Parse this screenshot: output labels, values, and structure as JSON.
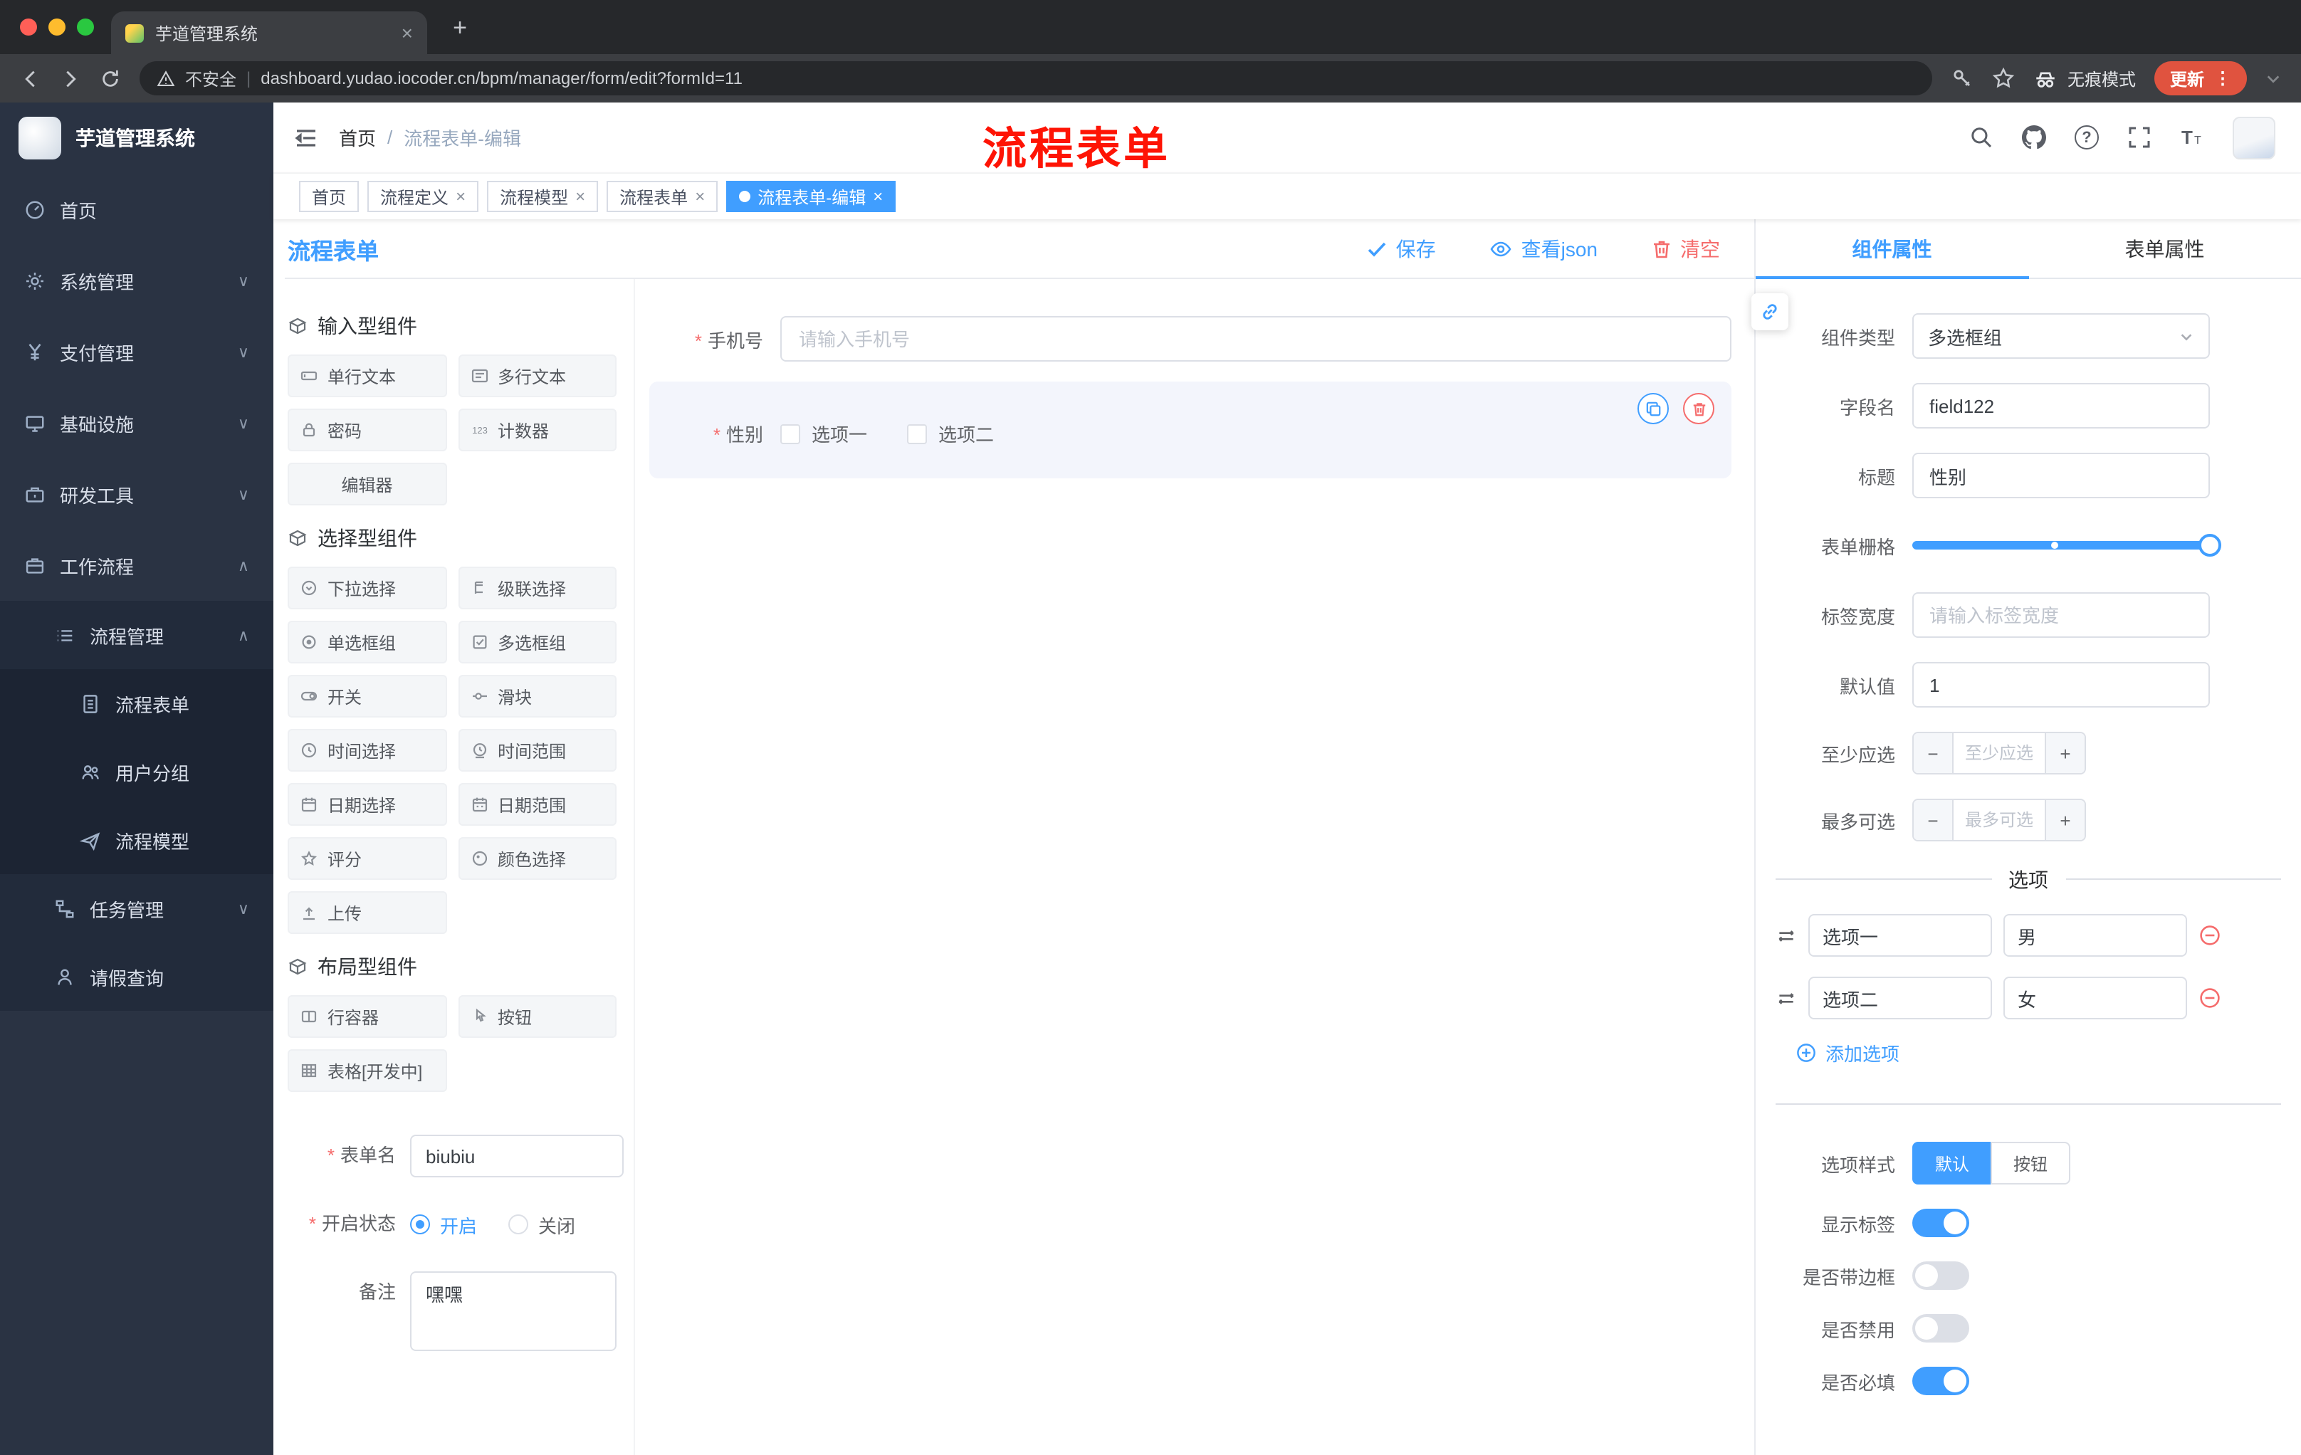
{
  "colors": {
    "accent": "#409eff",
    "danger": "#f56c6c",
    "update_pill": "#e0533f",
    "sidebar": "#2a3343",
    "active_tag": "#409eff"
  },
  "icons": {
    "close": "×",
    "plus": "+",
    "more": "⋮",
    "chevron_down": "∨",
    "chevron_up": "∧",
    "question": "?",
    "slash": "/",
    "pipe": "|",
    "minus": "−"
  },
  "browser": {
    "tab_title": "芋道管理系统",
    "security": "不安全",
    "url": "dashboard.yudao.iocoder.cn/bpm/manager/form/edit?formId=11",
    "incognito": "无痕模式",
    "update": "更新"
  },
  "sidebar": {
    "logo": "芋道管理系统",
    "menu": {
      "home": "首页",
      "system": "系统管理",
      "pay": "支付管理",
      "infra": "基础设施",
      "dev": "研发工具",
      "workflow": "工作流程",
      "process_mgmt": "流程管理",
      "process_form": "流程表单",
      "user_group": "用户分组",
      "process_model": "流程模型",
      "task_mgmt": "任务管理",
      "leave_query": "请假查询"
    }
  },
  "header": {
    "breadcrumb_home": "首页",
    "breadcrumb_current": "流程表单-编辑",
    "annotation": "流程表单"
  },
  "tags": [
    "首页",
    "流程定义",
    "流程模型",
    "流程表单",
    "流程表单-编辑"
  ],
  "designer": {
    "title": "流程表单",
    "save": "保存",
    "view_json": "查看json",
    "clear": "清空",
    "groups": {
      "input": "输入型组件",
      "select": "选择型组件",
      "layout": "布局型组件"
    },
    "items": {
      "single": "单行文本",
      "multi": "多行文本",
      "password": "密码",
      "counter": "计数器",
      "editor": "编辑器",
      "dropdown": "下拉选择",
      "cascade": "级联选择",
      "radio": "单选框组",
      "checkbox": "多选框组",
      "switch": "开关",
      "slider": "滑块",
      "time": "时间选择",
      "time_range": "时间范围",
      "date": "日期选择",
      "date_range": "日期范围",
      "rate": "评分",
      "color": "颜色选择",
      "upload": "上传",
      "row": "行容器",
      "button": "按钮",
      "table": "表格[开发中]"
    },
    "form": {
      "name_label": "表单名",
      "name_value": "biubiu",
      "status_label": "开启状态",
      "status_on": "开启",
      "status_off": "关闭",
      "remark_label": "备注",
      "remark_value": "嘿嘿"
    },
    "canvas": {
      "phone_label": "手机号",
      "phone_placeholder": "请输入手机号",
      "gender_label": "性别",
      "opt1": "选项一",
      "opt2": "选项二"
    }
  },
  "props": {
    "tab1": "组件属性",
    "tab2": "表单属性",
    "type_label": "组件类型",
    "type_value": "多选框组",
    "field_label": "字段名",
    "field_value": "field122",
    "title_label": "标题",
    "title_value": "性别",
    "grid_label": "表单栅格",
    "width_label": "标签宽度",
    "width_placeholder": "请输入标签宽度",
    "default_label": "默认值",
    "default_value": "1",
    "min_label": "至少应选",
    "min_placeholder": "至少应选",
    "max_label": "最多可选",
    "max_placeholder": "最多可选",
    "options_title": "选项",
    "opt1_name": "选项一",
    "opt1_value": "男",
    "opt2_name": "选项二",
    "opt2_value": "女",
    "add_option": "添加选项",
    "style_label": "选项样式",
    "style_default": "默认",
    "style_button": "按钮",
    "show_label": "显示标签",
    "border_label": "是否带边框",
    "disabled_label": "是否禁用",
    "required_label": "是否必填"
  }
}
